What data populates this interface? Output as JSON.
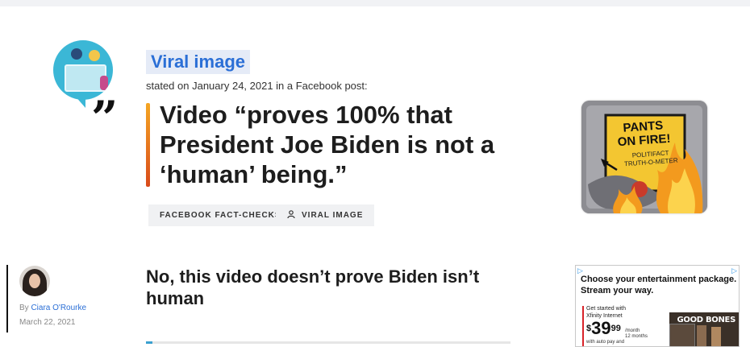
{
  "speaker": {
    "name": "Viral image",
    "stated": "stated on January 24, 2021 in a Facebook post:"
  },
  "claim": {
    "quote_mark": "”",
    "text": "Video “proves 100% that President Joe Biden is not a ‘human’ being.”"
  },
  "tags": [
    {
      "label": "FACEBOOK FACT-CHECKS",
      "icon": ""
    },
    {
      "label": "VIRAL IMAGE",
      "icon": "person-icon"
    }
  ],
  "rating": {
    "label_line1": "PANTS",
    "label_line2": "ON FIRE!",
    "brand_line1": "POLITIFACT",
    "brand_line2": "TRUTH-O-METER",
    "colors": {
      "frame": "#8a8a8f",
      "dial": "#f3c631",
      "flame": "#f39a1e",
      "flame_inner": "#fcd34d"
    }
  },
  "author": {
    "by": "By",
    "name": "Ciara O'Rourke",
    "date": "March 22, 2021"
  },
  "article": {
    "headline": "No, this video doesn’t prove Biden isn’t human"
  },
  "ad": {
    "headline": "Choose your entertainment package. Stream your way.",
    "offer_line1": "Get started with",
    "offer_line2": "Xfinity Internet",
    "price_symbol": "$",
    "price_dollars": "39",
    "price_cents": "99",
    "term_line1": "/month",
    "term_line2": "12 months",
    "fine_print": "with auto pay and",
    "image_title": "GOOD BONES",
    "adchoice_icon": "adchoices-icon"
  }
}
